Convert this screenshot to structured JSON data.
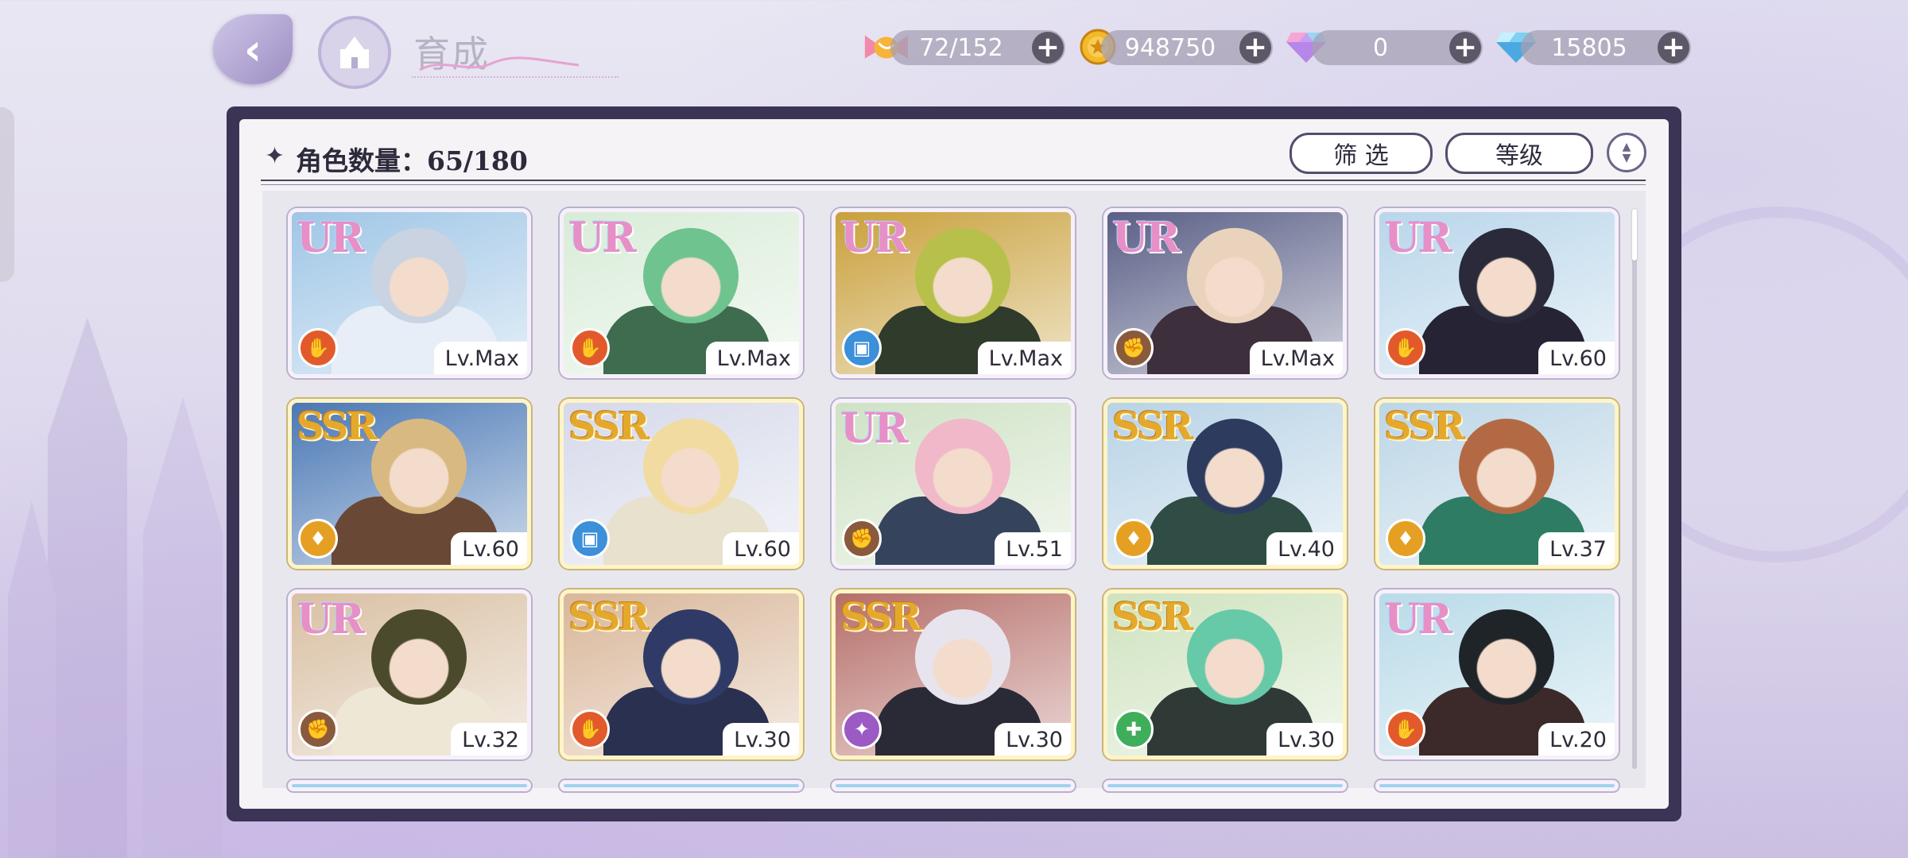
{
  "header": {
    "title": "育成",
    "resources": [
      {
        "icon": "candy-icon",
        "value": "72/152"
      },
      {
        "icon": "gold-coin-icon",
        "value": "948750"
      },
      {
        "icon": "rainbow-gem-icon",
        "value": "0"
      },
      {
        "icon": "blue-diamond-icon",
        "value": "15805"
      }
    ]
  },
  "panel": {
    "count_label": "角色数量：65/180",
    "filter_label": "筛 选",
    "sort_label": "等级"
  },
  "cards": [
    {
      "rarity": "UR",
      "level": "Lv.Max",
      "role_color": "#e25a2c",
      "bg": "#9fc6e6",
      "hair": "#c9d3e2",
      "cloth": "#e7eef7"
    },
    {
      "rarity": "UR",
      "level": "Lv.Max",
      "role_color": "#e25a2c",
      "bg": "#d9ecd8",
      "hair": "#6fc38e",
      "cloth": "#3f6c4f"
    },
    {
      "rarity": "UR",
      "level": "Lv.Max",
      "role_color": "#3c8fd9",
      "bg": "#c9a03b",
      "hair": "#b6c04a",
      "cloth": "#2f3b2b"
    },
    {
      "rarity": "UR",
      "level": "Lv.Max",
      "role_color": "#8a5a3c",
      "bg": "#5a5f86",
      "hair": "#e9d3bd",
      "cloth": "#3e2f3c"
    },
    {
      "rarity": "UR",
      "level": "Lv.60",
      "role_color": "#e25a2c",
      "bg": "#b9d6ea",
      "hair": "#2a2a3a",
      "cloth": "#262434"
    },
    {
      "rarity": "SSR",
      "level": "Lv.60",
      "role_color": "#e5a023",
      "bg": "#4a78b5",
      "hair": "#d9b982",
      "cloth": "#6a4836"
    },
    {
      "rarity": "SSR",
      "level": "Lv.60",
      "role_color": "#3c8fd9",
      "bg": "#d6d9ea",
      "hair": "#f1dba0",
      "cloth": "#e7e1cd"
    },
    {
      "rarity": "UR",
      "level": "Lv.51",
      "role_color": "#8a5a3c",
      "bg": "#cfe2c5",
      "hair": "#f0b8c8",
      "cloth": "#35445c"
    },
    {
      "rarity": "SSR",
      "level": "Lv.40",
      "role_color": "#e5a023",
      "bg": "#b8d3e6",
      "hair": "#2c3b5e",
      "cloth": "#2f4d44"
    },
    {
      "rarity": "SSR",
      "level": "Lv.37",
      "role_color": "#e5a023",
      "bg": "#bcd6e6",
      "hair": "#b36a44",
      "cloth": "#2f7c64"
    },
    {
      "rarity": "UR",
      "level": "Lv.32",
      "role_color": "#8a5a3c",
      "bg": "#d9c0a3",
      "hair": "#4b4a2c",
      "cloth": "#efe7d6"
    },
    {
      "rarity": "SSR",
      "level": "Lv.30",
      "role_color": "#e25a2c",
      "bg": "#d9b79a",
      "hair": "#2f3a66",
      "cloth": "#2a3050"
    },
    {
      "rarity": "SSR",
      "level": "Lv.30",
      "role_color": "#9b5ac4",
      "bg": "#b66f6a",
      "hair": "#e8e4ee",
      "cloth": "#2a2a36"
    },
    {
      "rarity": "SSR",
      "level": "Lv.30",
      "role_color": "#3fae5a",
      "bg": "#cfe3bf",
      "hair": "#66c9a8",
      "cloth": "#2f3a36"
    },
    {
      "rarity": "UR",
      "level": "Lv.20",
      "role_color": "#e25a2c",
      "bg": "#b9dbe8",
      "hair": "#1f2428",
      "cloth": "#3c2a2a"
    }
  ]
}
